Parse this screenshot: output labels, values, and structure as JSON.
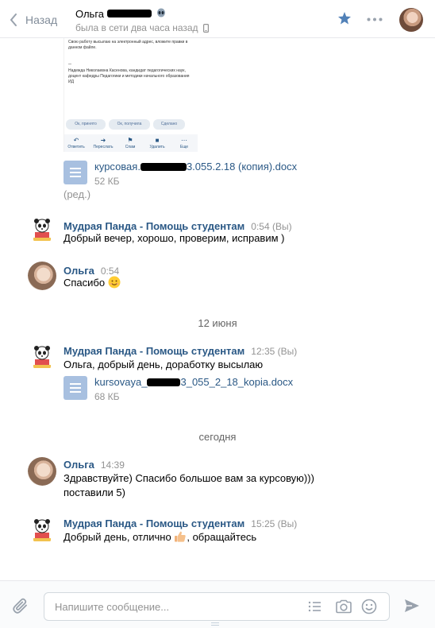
{
  "header": {
    "back_label": "Назад",
    "contact_name": "Ольга",
    "status": "была в сети два часа назад"
  },
  "screenshot_preview": {
    "top_text": "Свою работу высылаю на электронный адрес, вложите правки в данном файле.",
    "signature_dash": "--",
    "signature": "Надежда Николаевна Касенова, кандидат педагогических наук, доцент кафедры Педагогики и методики начального образования ИД",
    "chips": [
      "Ок, принято",
      "Ок, получила",
      "Сделано"
    ],
    "actions": [
      "Ответить",
      "Переслать",
      "Спам",
      "Удалить",
      "Еще"
    ]
  },
  "messages": [
    {
      "doc": {
        "name_start": "курсовая.",
        "name_end": "3.055.2.18 (копия).docx",
        "size": "52 КБ"
      },
      "edited": "(ред.)"
    },
    {
      "author": "Мудрая Панда - Помощь студентам",
      "time": "0:54 (Вы)",
      "text": "Добрый вечер, хорошо, проверим, исправим )"
    },
    {
      "author": "Ольга",
      "time": "0:54",
      "text": "Спасибо"
    },
    {
      "date": "12 июня"
    },
    {
      "author": "Мудрая Панда - Помощь студентам",
      "time": "12:35 (Вы)",
      "text": "Ольга, добрый день, доработку высылаю",
      "doc": {
        "name_start": "kursovaya_",
        "name_end": "3_055_2_18_kopia.docx",
        "size": "68 КБ"
      }
    },
    {
      "date": "сегодня"
    },
    {
      "author": "Ольга",
      "time": "14:39",
      "text_line1": "Здравствуйте) Спасибо большое вам за курсовую)))",
      "text_line2": "поставили 5)"
    },
    {
      "author": "Мудрая Панда - Помощь студентам",
      "time": "15:25 (Вы)",
      "text_before": "Добрый день, отлично",
      "text_after": ", обращайтесь"
    }
  ],
  "composer": {
    "placeholder": "Напишите сообщение..."
  },
  "icons": {
    "back": "chevron-left-icon",
    "star": "star-icon",
    "more": "more-dots-icon",
    "device": "phone-icon",
    "attach": "paperclip-icon",
    "templates": "list-icon",
    "camera": "camera-icon",
    "emoji": "smiley-icon",
    "send": "send-arrow-icon"
  },
  "colors": {
    "link": "#2a5885",
    "muted": "#939393",
    "accent": "#5181b8",
    "doc_icon": "#a8c0e0"
  }
}
